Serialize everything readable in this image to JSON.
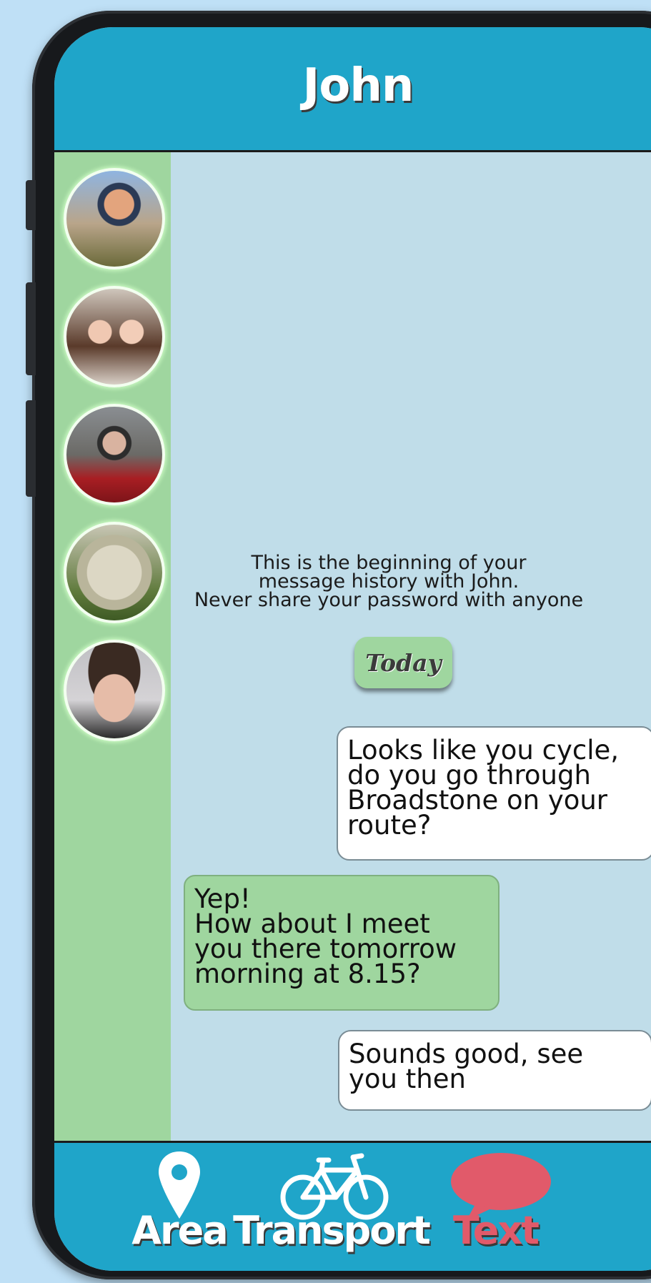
{
  "header": {
    "title": "John"
  },
  "sidebar": {
    "contacts": [
      {
        "name": "contact-1"
      },
      {
        "name": "contact-2"
      },
      {
        "name": "contact-3"
      },
      {
        "name": "contact-4"
      },
      {
        "name": "contact-5"
      }
    ]
  },
  "chat": {
    "history_note": [
      "This is the beginning of your",
      "message history with John.",
      "Never share your password with anyone"
    ],
    "date_badge": "Today",
    "messages": [
      {
        "direction": "outgoing",
        "lines": [
          "Looks like you cycle,",
          "do you go through",
          "Broadstone on your",
          "route?"
        ]
      },
      {
        "direction": "incoming",
        "lines": [
          "Yep!",
          "How about I meet",
          "you there tomorrow",
          "morning at 8.15?"
        ]
      },
      {
        "direction": "outgoing",
        "lines": [
          "Sounds good, see",
          "you then"
        ]
      }
    ]
  },
  "navbar": {
    "items": [
      {
        "label": "Area",
        "icon": "map-pin-icon",
        "active": false
      },
      {
        "label": "Transport",
        "icon": "bicycle-icon",
        "active": false
      },
      {
        "label": "Text",
        "icon": "speech-bubble-icon",
        "active": true
      }
    ]
  },
  "colors": {
    "background": "#bfe0f6",
    "header": "#1fa5c9",
    "sidebar": "#9fd69f",
    "chat_background": "#c0dde9",
    "incoming_bubble": "#9fd69f",
    "outgoing_bubble": "#ffffff",
    "active_nav": "#e15a6a",
    "phone_frame": "#17191c"
  }
}
